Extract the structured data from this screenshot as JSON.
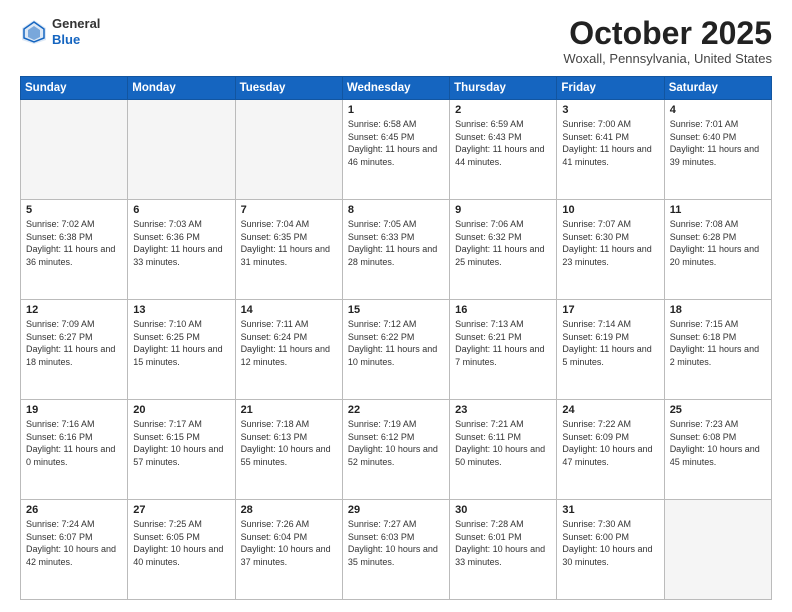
{
  "header": {
    "logo_line1": "General",
    "logo_line2": "Blue",
    "month": "October 2025",
    "location": "Woxall, Pennsylvania, United States"
  },
  "weekdays": [
    "Sunday",
    "Monday",
    "Tuesday",
    "Wednesday",
    "Thursday",
    "Friday",
    "Saturday"
  ],
  "weeks": [
    [
      {
        "day": "",
        "text": "",
        "empty": true
      },
      {
        "day": "",
        "text": "",
        "empty": true
      },
      {
        "day": "",
        "text": "",
        "empty": true
      },
      {
        "day": "1",
        "text": "Sunrise: 6:58 AM\nSunset: 6:45 PM\nDaylight: 11 hours\nand 46 minutes.",
        "empty": false
      },
      {
        "day": "2",
        "text": "Sunrise: 6:59 AM\nSunset: 6:43 PM\nDaylight: 11 hours\nand 44 minutes.",
        "empty": false
      },
      {
        "day": "3",
        "text": "Sunrise: 7:00 AM\nSunset: 6:41 PM\nDaylight: 11 hours\nand 41 minutes.",
        "empty": false
      },
      {
        "day": "4",
        "text": "Sunrise: 7:01 AM\nSunset: 6:40 PM\nDaylight: 11 hours\nand 39 minutes.",
        "empty": false
      }
    ],
    [
      {
        "day": "5",
        "text": "Sunrise: 7:02 AM\nSunset: 6:38 PM\nDaylight: 11 hours\nand 36 minutes.",
        "empty": false
      },
      {
        "day": "6",
        "text": "Sunrise: 7:03 AM\nSunset: 6:36 PM\nDaylight: 11 hours\nand 33 minutes.",
        "empty": false
      },
      {
        "day": "7",
        "text": "Sunrise: 7:04 AM\nSunset: 6:35 PM\nDaylight: 11 hours\nand 31 minutes.",
        "empty": false
      },
      {
        "day": "8",
        "text": "Sunrise: 7:05 AM\nSunset: 6:33 PM\nDaylight: 11 hours\nand 28 minutes.",
        "empty": false
      },
      {
        "day": "9",
        "text": "Sunrise: 7:06 AM\nSunset: 6:32 PM\nDaylight: 11 hours\nand 25 minutes.",
        "empty": false
      },
      {
        "day": "10",
        "text": "Sunrise: 7:07 AM\nSunset: 6:30 PM\nDaylight: 11 hours\nand 23 minutes.",
        "empty": false
      },
      {
        "day": "11",
        "text": "Sunrise: 7:08 AM\nSunset: 6:28 PM\nDaylight: 11 hours\nand 20 minutes.",
        "empty": false
      }
    ],
    [
      {
        "day": "12",
        "text": "Sunrise: 7:09 AM\nSunset: 6:27 PM\nDaylight: 11 hours\nand 18 minutes.",
        "empty": false
      },
      {
        "day": "13",
        "text": "Sunrise: 7:10 AM\nSunset: 6:25 PM\nDaylight: 11 hours\nand 15 minutes.",
        "empty": false
      },
      {
        "day": "14",
        "text": "Sunrise: 7:11 AM\nSunset: 6:24 PM\nDaylight: 11 hours\nand 12 minutes.",
        "empty": false
      },
      {
        "day": "15",
        "text": "Sunrise: 7:12 AM\nSunset: 6:22 PM\nDaylight: 11 hours\nand 10 minutes.",
        "empty": false
      },
      {
        "day": "16",
        "text": "Sunrise: 7:13 AM\nSunset: 6:21 PM\nDaylight: 11 hours\nand 7 minutes.",
        "empty": false
      },
      {
        "day": "17",
        "text": "Sunrise: 7:14 AM\nSunset: 6:19 PM\nDaylight: 11 hours\nand 5 minutes.",
        "empty": false
      },
      {
        "day": "18",
        "text": "Sunrise: 7:15 AM\nSunset: 6:18 PM\nDaylight: 11 hours\nand 2 minutes.",
        "empty": false
      }
    ],
    [
      {
        "day": "19",
        "text": "Sunrise: 7:16 AM\nSunset: 6:16 PM\nDaylight: 11 hours\nand 0 minutes.",
        "empty": false
      },
      {
        "day": "20",
        "text": "Sunrise: 7:17 AM\nSunset: 6:15 PM\nDaylight: 10 hours\nand 57 minutes.",
        "empty": false
      },
      {
        "day": "21",
        "text": "Sunrise: 7:18 AM\nSunset: 6:13 PM\nDaylight: 10 hours\nand 55 minutes.",
        "empty": false
      },
      {
        "day": "22",
        "text": "Sunrise: 7:19 AM\nSunset: 6:12 PM\nDaylight: 10 hours\nand 52 minutes.",
        "empty": false
      },
      {
        "day": "23",
        "text": "Sunrise: 7:21 AM\nSunset: 6:11 PM\nDaylight: 10 hours\nand 50 minutes.",
        "empty": false
      },
      {
        "day": "24",
        "text": "Sunrise: 7:22 AM\nSunset: 6:09 PM\nDaylight: 10 hours\nand 47 minutes.",
        "empty": false
      },
      {
        "day": "25",
        "text": "Sunrise: 7:23 AM\nSunset: 6:08 PM\nDaylight: 10 hours\nand 45 minutes.",
        "empty": false
      }
    ],
    [
      {
        "day": "26",
        "text": "Sunrise: 7:24 AM\nSunset: 6:07 PM\nDaylight: 10 hours\nand 42 minutes.",
        "empty": false
      },
      {
        "day": "27",
        "text": "Sunrise: 7:25 AM\nSunset: 6:05 PM\nDaylight: 10 hours\nand 40 minutes.",
        "empty": false
      },
      {
        "day": "28",
        "text": "Sunrise: 7:26 AM\nSunset: 6:04 PM\nDaylight: 10 hours\nand 37 minutes.",
        "empty": false
      },
      {
        "day": "29",
        "text": "Sunrise: 7:27 AM\nSunset: 6:03 PM\nDaylight: 10 hours\nand 35 minutes.",
        "empty": false
      },
      {
        "day": "30",
        "text": "Sunrise: 7:28 AM\nSunset: 6:01 PM\nDaylight: 10 hours\nand 33 minutes.",
        "empty": false
      },
      {
        "day": "31",
        "text": "Sunrise: 7:30 AM\nSunset: 6:00 PM\nDaylight: 10 hours\nand 30 minutes.",
        "empty": false
      },
      {
        "day": "",
        "text": "",
        "empty": true
      }
    ]
  ]
}
